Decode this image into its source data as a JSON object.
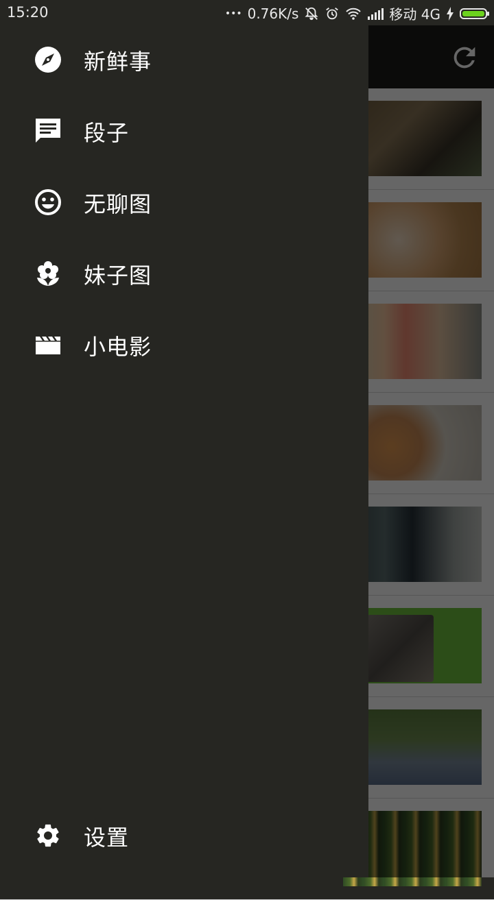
{
  "status_bar": {
    "time": "15:20",
    "dots": "•••",
    "network_speed": "0.76K/s",
    "carrier": "移动 4G",
    "icons": [
      "bell-off-icon",
      "alarm-icon",
      "wifi-icon",
      "signal-icon",
      "charging-icon",
      "battery-icon"
    ],
    "battery_color": "#6cd21e"
  },
  "drawer": {
    "background": "#262622",
    "items": [
      {
        "label": "新鲜事",
        "icon": "compass-icon"
      },
      {
        "label": "段子",
        "icon": "chat-message-icon"
      },
      {
        "label": "无聊图",
        "icon": "smiley-icon"
      },
      {
        "label": "妹子图",
        "icon": "flower-icon"
      },
      {
        "label": "小电影",
        "icon": "movie-clapper-icon"
      }
    ],
    "settings": {
      "label": "设置",
      "icon": "gear-icon"
    }
  },
  "background_app": {
    "toolbar": {
      "action_icon": "refresh-icon"
    },
    "feed_thumbnails": [
      "soldier",
      "dog",
      "two-women",
      "cat-on-sofa",
      "hotel-corridor",
      "cat-on-green",
      "woman-sitting-on-grass",
      "beer-bottles"
    ]
  }
}
